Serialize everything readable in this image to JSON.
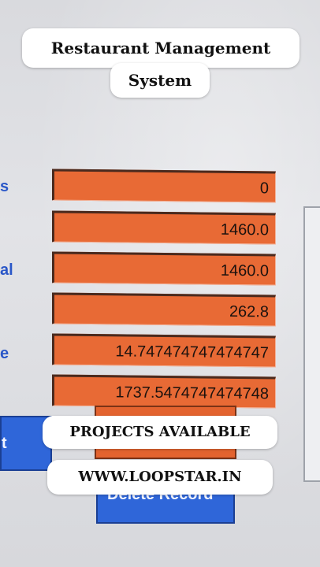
{
  "overlay": {
    "title_line1": "Restaurant Management",
    "title_line2": "System",
    "projects": "PROJECTS AVAILABLE",
    "website": "WWW.LOOPSTAR.IN"
  },
  "side_labels": [
    "s",
    "al",
    "e"
  ],
  "fields": [
    {
      "value": "0"
    },
    {
      "value": "1460.0"
    },
    {
      "value": "1460.0"
    },
    {
      "value": "262.8"
    },
    {
      "value": "14.747474747474747"
    },
    {
      "value": "1737.5474747474748"
    }
  ],
  "buttons": {
    "left_partial": "t",
    "delete_record": "Delete Record"
  },
  "colors": {
    "field": "#e86a35",
    "button_blue": "#2f66d9",
    "label_blue": "#2a57c8"
  }
}
